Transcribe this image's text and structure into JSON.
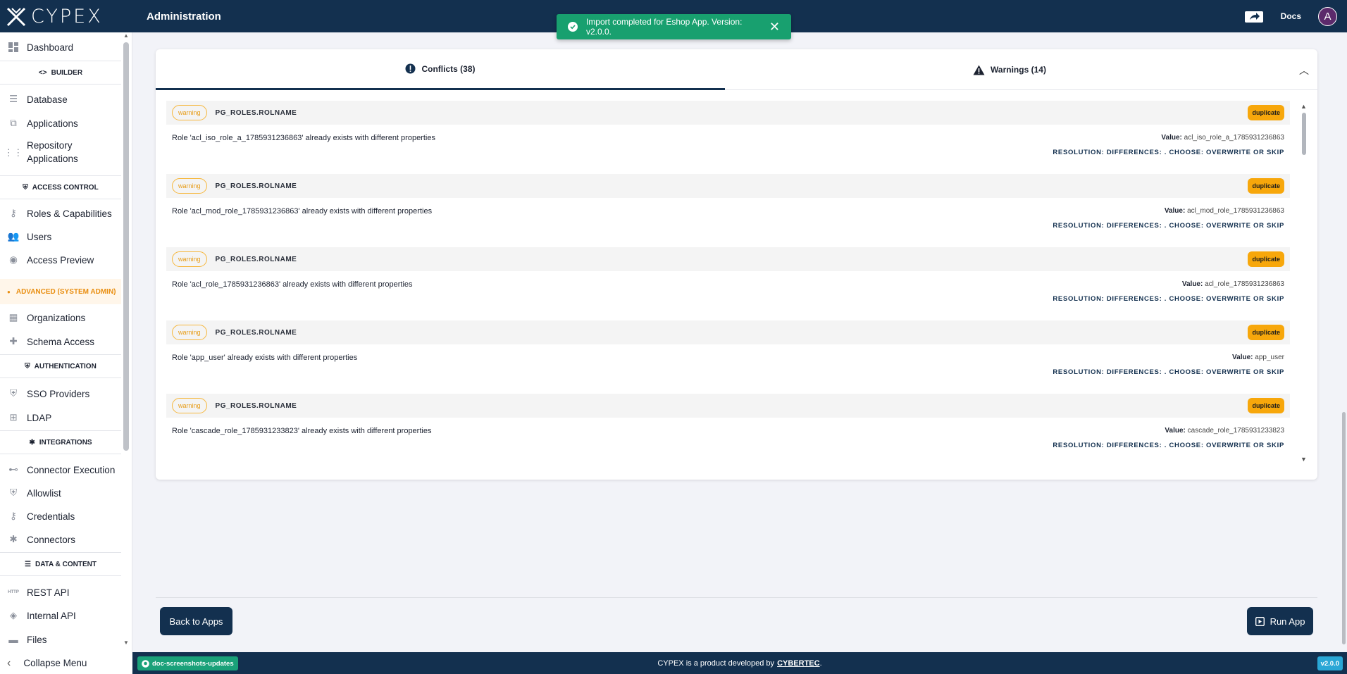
{
  "app": {
    "logo_text": "CYPEX",
    "page_title": "Administration",
    "docs_label": "Docs",
    "avatar_letter": "A"
  },
  "toast": {
    "message": "Import completed for Eshop App. Version: v2.0.0."
  },
  "sidebar": {
    "dashboard": "Dashboard",
    "section_builder": "BUILDER",
    "database": "Database",
    "applications": "Applications",
    "repository_applications": "Repository Applications",
    "section_access_control": "ACCESS CONTROL",
    "roles": "Roles & Capabilities",
    "users": "Users",
    "access_preview": "Access Preview",
    "section_advanced": "ADVANCED (SYSTEM ADMIN)",
    "organizations": "Organizations",
    "schema_access": "Schema Access",
    "section_authentication": "AUTHENTICATION",
    "sso_providers": "SSO Providers",
    "ldap": "LDAP",
    "section_integrations": "INTEGRATIONS",
    "connector_execution": "Connector Execution",
    "allowlist": "Allowlist",
    "credentials": "Credentials",
    "connectors": "Connectors",
    "section_data_content": "DATA & CONTENT",
    "rest_api": "REST API",
    "rest_api_icon_text": "HTTP",
    "internal_api": "Internal API",
    "files": "Files",
    "collapse": "Collapse Menu"
  },
  "tabs": {
    "conflicts": "Conflicts (38)",
    "warnings": "Warnings (14)"
  },
  "conflicts": [
    {
      "level": "warning",
      "field": "PG_ROLES.ROLNAME",
      "type": "duplicate",
      "message": "Role 'acl_iso_role_a_1785931236863' already exists with different properties",
      "value_label": "Value:",
      "value": "acl_iso_role_a_1785931236863",
      "resolution": "RESOLUTION: DIFFERENCES: . CHOOSE: OVERWRITE OR SKIP"
    },
    {
      "level": "warning",
      "field": "PG_ROLES.ROLNAME",
      "type": "duplicate",
      "message": "Role 'acl_mod_role_1785931236863' already exists with different properties",
      "value_label": "Value:",
      "value": "acl_mod_role_1785931236863",
      "resolution": "RESOLUTION: DIFFERENCES: . CHOOSE: OVERWRITE OR SKIP"
    },
    {
      "level": "warning",
      "field": "PG_ROLES.ROLNAME",
      "type": "duplicate",
      "message": "Role 'acl_role_1785931236863' already exists with different properties",
      "value_label": "Value:",
      "value": "acl_role_1785931236863",
      "resolution": "RESOLUTION: DIFFERENCES: . CHOOSE: OVERWRITE OR SKIP"
    },
    {
      "level": "warning",
      "field": "PG_ROLES.ROLNAME",
      "type": "duplicate",
      "message": "Role 'app_user' already exists with different properties",
      "value_label": "Value:",
      "value": "app_user",
      "resolution": "RESOLUTION: DIFFERENCES: . CHOOSE: OVERWRITE OR SKIP"
    },
    {
      "level": "warning",
      "field": "PG_ROLES.ROLNAME",
      "type": "duplicate",
      "message": "Role 'cascade_role_1785931233823' already exists with different properties",
      "value_label": "Value:",
      "value": "cascade_role_1785931233823",
      "resolution": "RESOLUTION: DIFFERENCES: . CHOOSE: OVERWRITE OR SKIP"
    }
  ],
  "footer": {
    "back_label": "Back to Apps",
    "run_label": "Run App"
  },
  "statusbar": {
    "branch": "doc-screenshots-updates",
    "text": "CYPEX is a product developed by",
    "company": "CYBERTEC",
    "period": ".",
    "version": "v2.0.0"
  },
  "colors": {
    "primary": "#13304f",
    "success": "#18a06f",
    "warning": "#f7a70b",
    "advanced": "#e98e10"
  }
}
